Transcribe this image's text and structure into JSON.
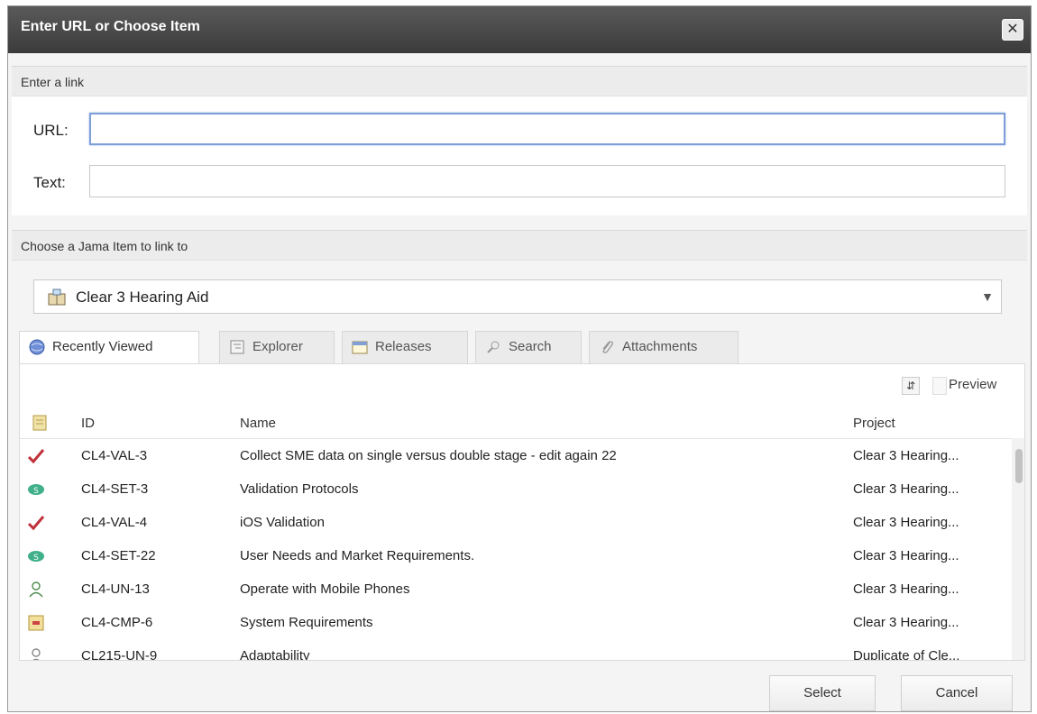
{
  "dialog": {
    "title": "Enter URL or Choose Item",
    "close_icon": "close-icon"
  },
  "link_section": {
    "header": "Enter a link",
    "url_label": "URL:",
    "url_value": "",
    "text_label": "Text:",
    "text_value": ""
  },
  "item_section": {
    "header": "Choose a Jama Item to link to",
    "project": "Clear 3 Hearing Aid",
    "project_icon": "project-icon"
  },
  "tabs": [
    {
      "label": "Recently Viewed",
      "icon": "globe-icon",
      "active": true
    },
    {
      "label": "Explorer",
      "icon": "tree-icon",
      "active": false
    },
    {
      "label": "Releases",
      "icon": "calendar-icon",
      "active": false
    },
    {
      "label": "Search",
      "icon": "search-icon",
      "active": false
    },
    {
      "label": "Attachments",
      "icon": "paperclip-icon",
      "active": false
    }
  ],
  "toolbar": {
    "refresh_icon": "refresh-icon",
    "preview_label": "Preview"
  },
  "grid": {
    "columns": {
      "type": "",
      "id": "ID",
      "name": "Name",
      "project": "Project"
    },
    "rows": [
      {
        "icon": "validation-check-icon",
        "id": "CL4-VAL-3",
        "name": "Collect SME data on single versus double stage - edit again 22",
        "project": "Clear 3 Hearing..."
      },
      {
        "icon": "set-icon",
        "id": "CL4-SET-3",
        "name": "Validation Protocols",
        "project": "Clear 3 Hearing..."
      },
      {
        "icon": "validation-check-icon",
        "id": "CL4-VAL-4",
        "name": "iOS Validation",
        "project": "Clear 3 Hearing..."
      },
      {
        "icon": "set-icon",
        "id": "CL4-SET-22",
        "name": "User Needs and Market Requirements.",
        "project": "Clear 3 Hearing..."
      },
      {
        "icon": "user-need-icon",
        "id": "CL4-UN-13",
        "name": "Operate with Mobile Phones",
        "project": "Clear 3 Hearing..."
      },
      {
        "icon": "component-icon",
        "id": "CL4-CMP-6",
        "name": "System Requirements",
        "project": "Clear 3 Hearing..."
      },
      {
        "icon": "user-need-icon",
        "id": "CL215-UN-9",
        "name": "Adaptability",
        "project": "Duplicate of Cle..."
      }
    ]
  },
  "footer": {
    "select_label": "Select",
    "cancel_label": "Cancel"
  }
}
